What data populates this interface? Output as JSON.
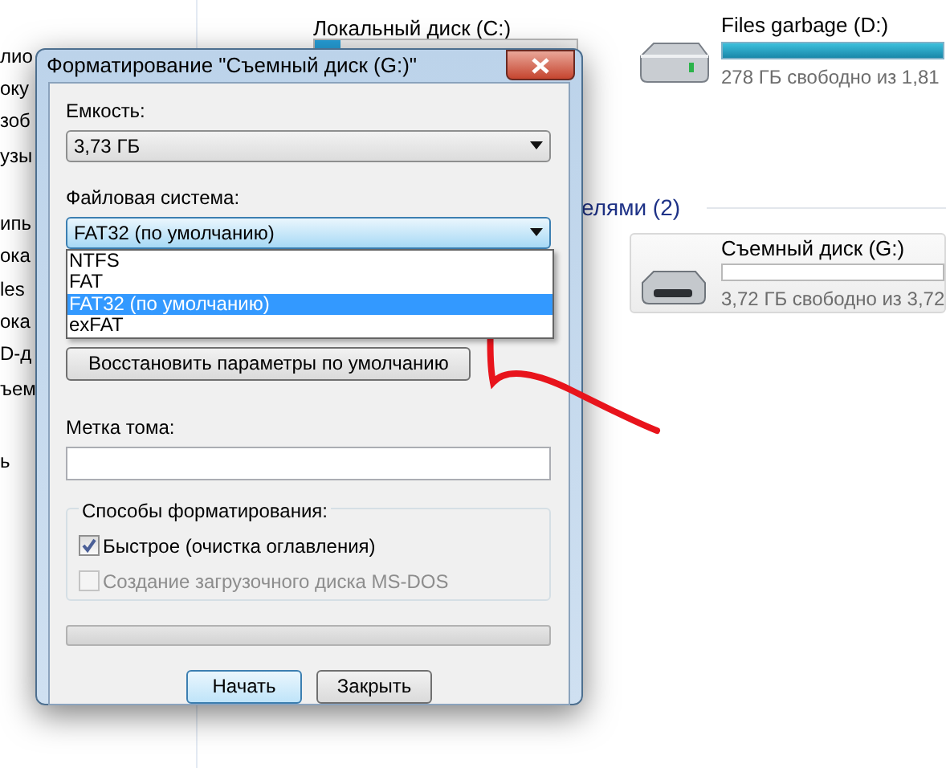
{
  "explorer": {
    "sidebar_items": [
      "лио",
      "оку",
      "зоб",
      "узы",
      "ипь",
      "ока",
      "les",
      "ока",
      "D-д",
      "ъем",
      "ь"
    ],
    "drives": [
      {
        "name": "Локальный диск (C:)",
        "level": 0.1
      },
      {
        "name": "Files garbage (D:)",
        "level": 1,
        "free": "278 ГБ свободно из 1,81"
      }
    ],
    "group_heading": "елями (2)",
    "removable": {
      "name": "Съемный диск (G:)",
      "level": 0,
      "free": "3,72 ГБ свободно из 3,72"
    }
  },
  "dialog": {
    "title": "Форматирование \"Съемный диск (G:)\"",
    "capacity": {
      "label": "Емкость:",
      "value": "3,73 ГБ"
    },
    "file_system": {
      "label": "Файловая система:",
      "value": "FAT32 (по умолчанию)",
      "expanded": true,
      "options": [
        {
          "label": "NTFS",
          "selected": false
        },
        {
          "label": "FAT",
          "selected": false
        },
        {
          "label": "FAT32 (по умолчанию)",
          "selected": true
        },
        {
          "label": "exFAT",
          "selected": false
        }
      ]
    },
    "restore_button": "Восстановить параметры по умолчанию",
    "volume_label": {
      "label": "Метка тома:"
    },
    "format_options": {
      "legend": "Способы форматирования:",
      "items": [
        {
          "label": "Быстрое (очистка оглавления)",
          "checked": true,
          "disabled": false
        },
        {
          "label": "Создание загрузочного диска MS-DOS",
          "checked": false,
          "disabled": true
        }
      ]
    },
    "progress": {
      "level": 0
    },
    "buttons": [
      {
        "label": "Начать",
        "default": true
      },
      {
        "label": "Закрыть",
        "default": false
      }
    ]
  }
}
